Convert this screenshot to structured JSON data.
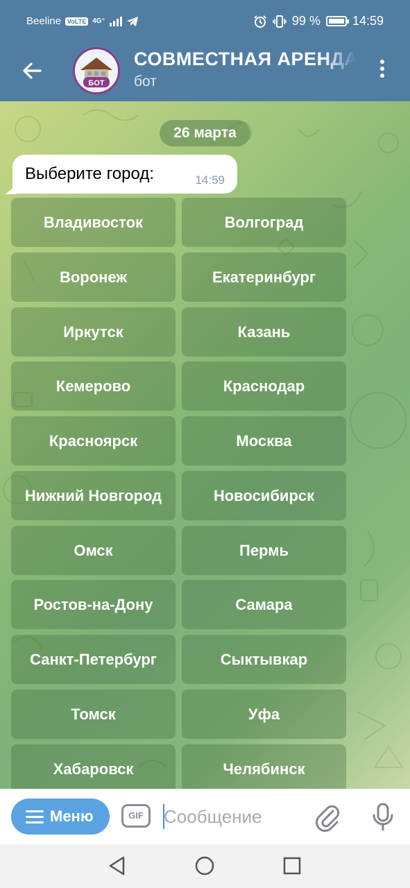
{
  "status": {
    "carrier": "Beeline",
    "volte": "VoLTE",
    "network": "4G⁺",
    "battery": "99 %",
    "time": "14:59"
  },
  "header": {
    "back_icon": "arrow-back-icon",
    "avatar_badge": "БОТ",
    "title": "СОВМЕСТНАЯ АРЕНДА",
    "subtitle": "бот",
    "more_icon": "more-vertical-icon"
  },
  "chat": {
    "date": "26 марта",
    "message": {
      "text": "Выберите город:",
      "time": "14:59"
    },
    "keyboard": [
      [
        "Владивосток",
        "Волгоград"
      ],
      [
        "Воронеж",
        "Екатеринбург"
      ],
      [
        "Иркутск",
        "Казань"
      ],
      [
        "Кемерово",
        "Краснодар"
      ],
      [
        "Красноярск",
        "Москва"
      ],
      [
        "Нижний Новгород",
        "Новосибирск"
      ],
      [
        "Омск",
        "Пермь"
      ],
      [
        "Ростов-на-Дону",
        "Самара"
      ],
      [
        "Санкт-Петербург",
        "Сыктывкар"
      ],
      [
        "Томск",
        "Уфа"
      ],
      [
        "Хабаровск",
        "Челябинск"
      ]
    ]
  },
  "input": {
    "menu_label": "Меню",
    "gif_label": "GIF",
    "placeholder": "Сообщение",
    "value": ""
  },
  "colors": {
    "header": "#517da2",
    "menu_button": "#5aa3e0",
    "accent": "#4a8fd0"
  }
}
